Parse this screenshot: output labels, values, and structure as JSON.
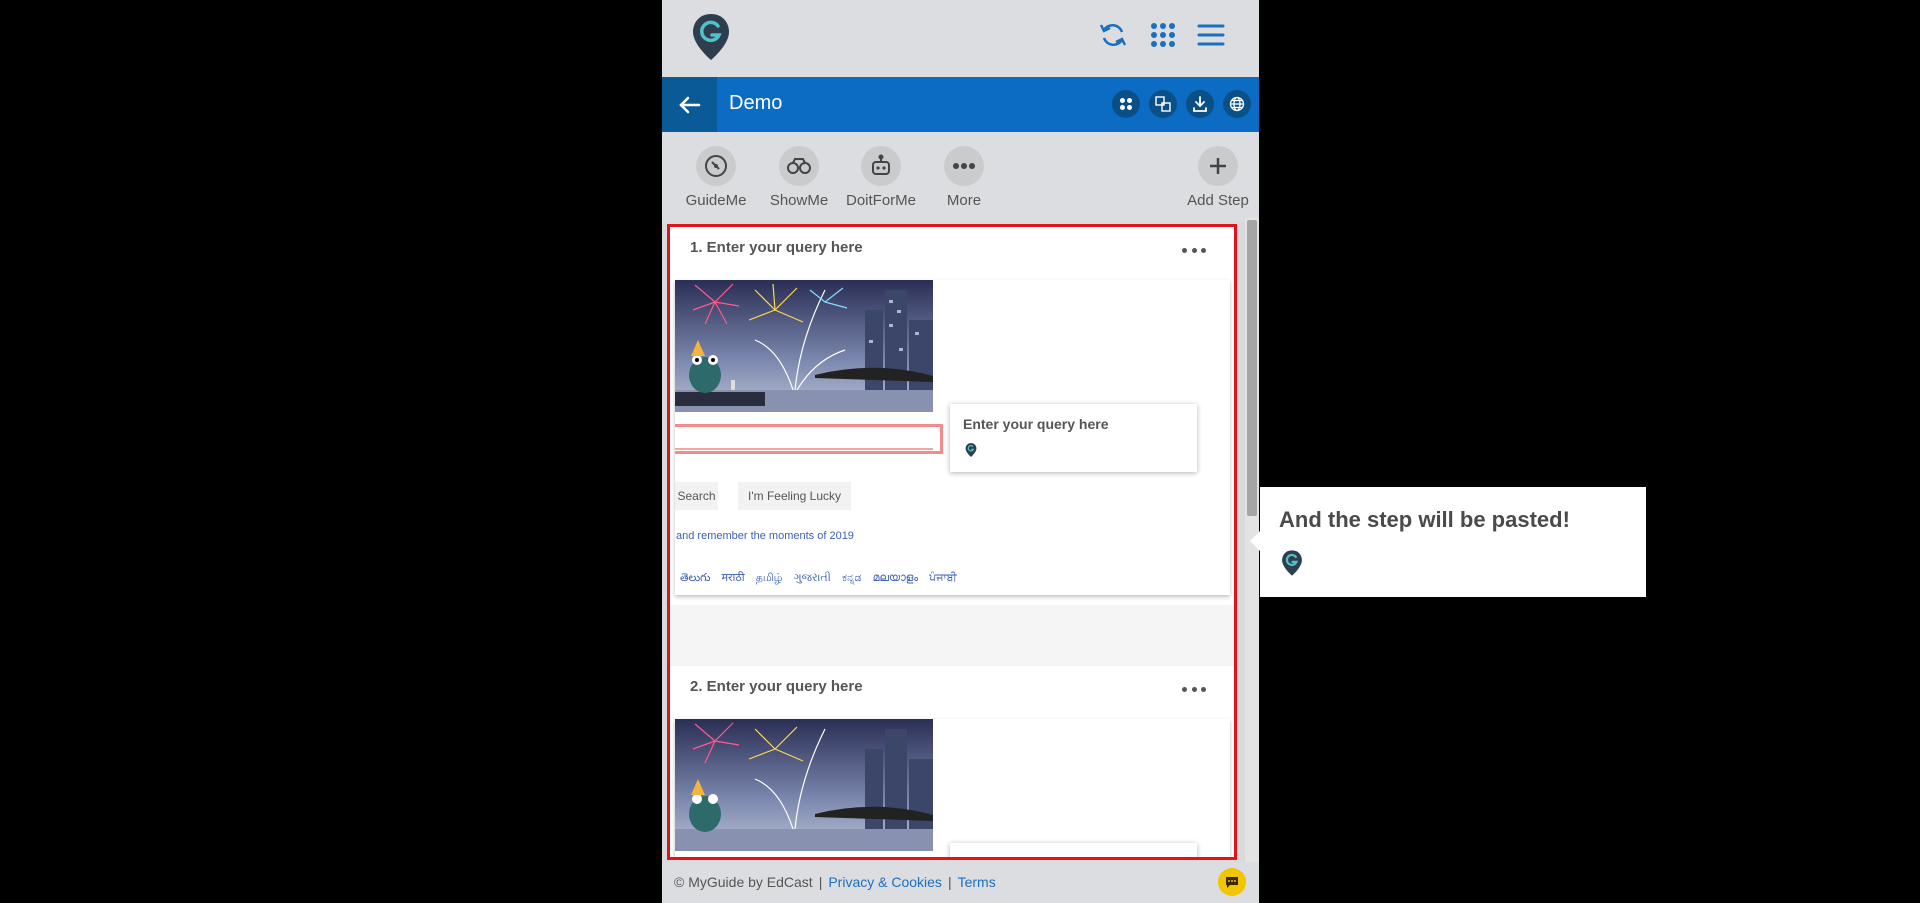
{
  "header": {
    "title": "Demo"
  },
  "toolbar": {
    "items": [
      {
        "label": "GuideMe",
        "icon": "compass-icon"
      },
      {
        "label": "ShowMe",
        "icon": "binoculars-icon"
      },
      {
        "label": "DoitForMe",
        "icon": "robot-icon"
      },
      {
        "label": "More",
        "icon": "more-dots-icon"
      },
      {
        "label": "Add Step",
        "icon": "plus-icon"
      }
    ]
  },
  "steps": [
    {
      "title": "1. Enter your query here",
      "screenshot": {
        "tooltip_text": "Enter your query here",
        "search_button": "Search",
        "lucky_button": "I'm Feeling Lucky",
        "doodle_link": "and remember the moments of 2019",
        "languages": [
          "తెలుగు",
          "मराठी",
          "தமிழ்",
          "ગુજરાતી",
          "ಕನ್ನಡ",
          "മലയാളം",
          "ਪੰਜਾਬੀ"
        ]
      }
    },
    {
      "title": "2. Enter your query here"
    }
  ],
  "footer": {
    "copyright": "© MyGuide by EdCast",
    "privacy": "Privacy & Cookies",
    "terms": "Terms"
  },
  "overlay_tooltip": {
    "text": "And the step will be pasted!"
  },
  "colors": {
    "brand_blue": "#0c6cc4",
    "highlight_red": "#e0131a",
    "logo_dark": "#2f3e4e",
    "logo_teal": "#4fc3c9"
  }
}
